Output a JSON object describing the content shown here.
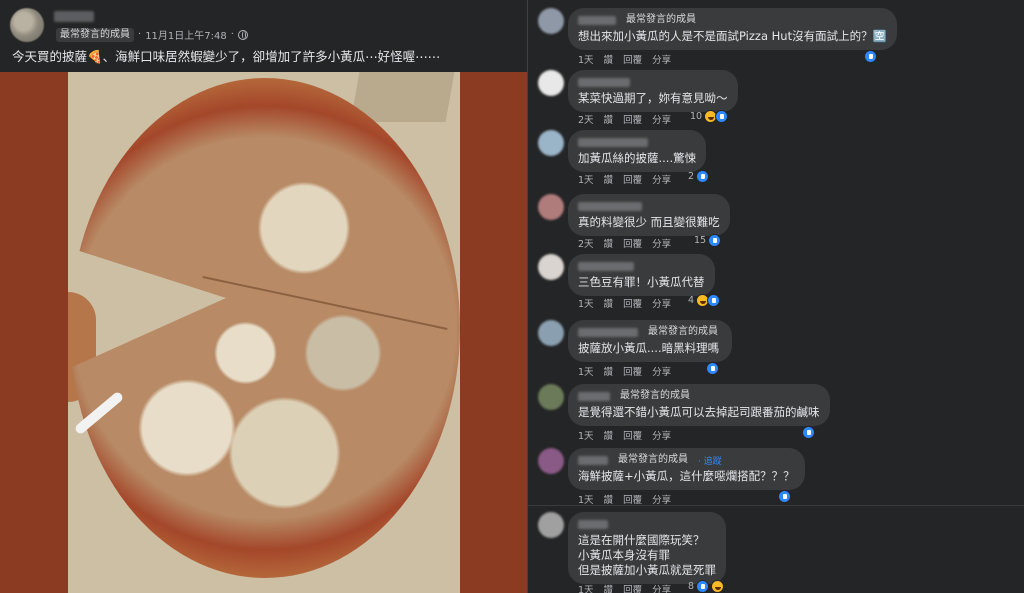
{
  "post": {
    "badge": "最常發言的成員",
    "time": "11月1日上午7:48",
    "dot": "·",
    "text": "今天買的披薩🍕、海鮮口味居然蝦變少了，卻增加了許多小黃瓜⋯好怪喔⋯⋯"
  },
  "action_labels": {
    "reply": "回覆",
    "share": "分享",
    "like": "讚"
  },
  "comments": [
    {
      "badge": "最常發言的成員",
      "text": "想出來加小黃瓜的人是不是面試Pizza Hut沒有面試上的？🈳",
      "time": "1天",
      "count": ""
    },
    {
      "badge": "",
      "text": "某菜快過期了，妳有意見呦～",
      "time": "2天",
      "count": "10"
    },
    {
      "badge": "",
      "text": "加黃瓜絲的披薩....驚悚",
      "time": "1天",
      "count": "2"
    },
    {
      "badge": "",
      "text": "真的料變很少 而且變很難吃",
      "time": "2天",
      "count": "15"
    },
    {
      "badge": "",
      "text": "三色豆有罪！小黃瓜代替",
      "time": "1天",
      "count": "4"
    },
    {
      "badge": "最常發言的成員",
      "text": "披薩放小黃瓜....暗黑料理嗎",
      "time": "1天",
      "count": ""
    },
    {
      "badge": "最常發言的成員",
      "text": "是覺得還不錯小黃瓜可以去掉起司跟番茄的鹹味",
      "time": "1天",
      "count": ""
    },
    {
      "badge": "最常發言的成員",
      "extra": "· 追蹤",
      "text": "海鮮披薩+小黃瓜，這什麼噁爛搭配？？？",
      "time": "1天",
      "count": ""
    },
    {
      "badge": "",
      "lines": [
        "這是在開什麼國際玩笑？",
        "小黃瓜本身沒有罪",
        "但是披薩加小黃瓜就是死罪"
      ],
      "time": "1天",
      "count": "8"
    }
  ]
}
